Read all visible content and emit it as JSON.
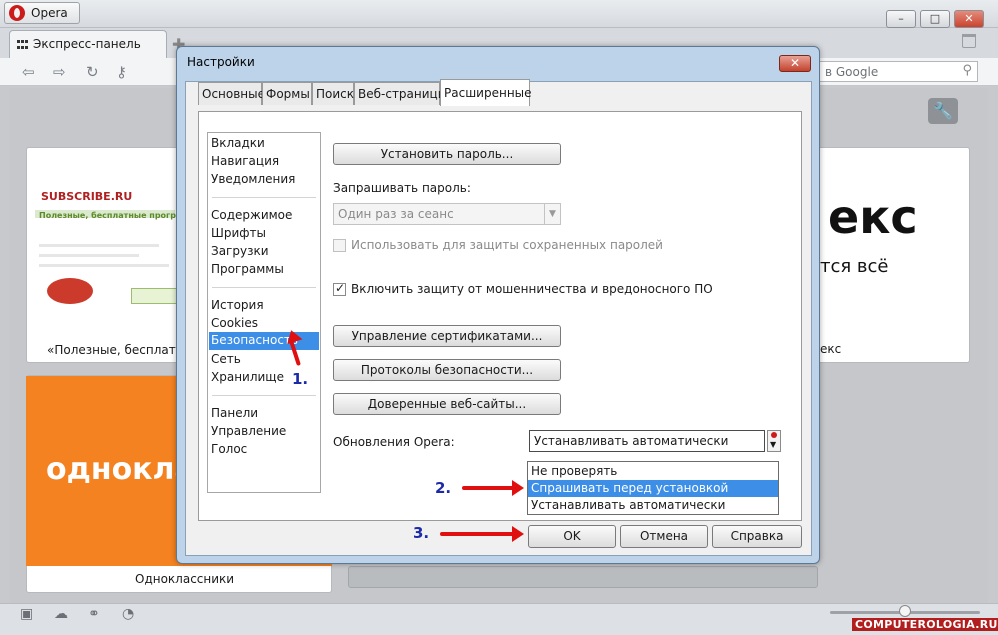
{
  "browser": {
    "app_button": "Opera",
    "tab_label": "Экспресс-панель",
    "search_placeholder": "в Google"
  },
  "speed_dial": {
    "thumb1": {
      "logo": "SUBSCRIBE.RU",
      "headline": "Полезные, бесплатные программ",
      "caption": "«Полезные, бесплатны"
    },
    "thumb2": {
      "big": "екс",
      "small": "тся всё",
      "caption": "екс"
    },
    "thumb3": {
      "text": "однокла",
      "caption": "Одноклассники"
    }
  },
  "dialog": {
    "title": "Настройки",
    "tabs": [
      "Основные",
      "Формы",
      "Поиск",
      "Веб-страницы",
      "Расширенные"
    ],
    "categories": {
      "group1": [
        "Вкладки",
        "Навигация",
        "Уведомления"
      ],
      "group2": [
        "Содержимое",
        "Шрифты",
        "Загрузки",
        "Программы"
      ],
      "group3": [
        "История",
        "Cookies",
        "Безопасность",
        "Сеть",
        "Хранилище"
      ],
      "group4": [
        "Панели",
        "Управление",
        "Голос"
      ]
    },
    "security": {
      "set_password_button": "Установить пароль...",
      "ask_password_label": "Запрашивать пароль:",
      "ask_password_value": "Один раз за сеанс",
      "use_for_saved_passwords": "Использовать для защиты сохраненных паролей",
      "fraud_protection": "Включить защиту от мошенничества и вредоносного ПО",
      "manage_certificates_button": "Управление сертификатами...",
      "security_protocols_button": "Протоколы безопасности...",
      "trusted_sites_button": "Доверенные веб-сайты...",
      "updates_label": "Обновления Opera:",
      "updates_value": "Устанавливать автоматически",
      "updates_options": [
        "Не проверять",
        "Спрашивать перед установкой",
        "Устанавливать автоматически"
      ]
    },
    "buttons": {
      "ok": "OK",
      "cancel": "Отмена",
      "help": "Справка"
    }
  },
  "annotations": {
    "step1": "1.",
    "step2": "2.",
    "step3": "3."
  },
  "watermark": "COMPUTEROLOGIA.RU",
  "colors": {
    "selection": "#3d8ee6",
    "arrow": "#e01010",
    "note": "#1b2aa8",
    "orange_tile": "#f58220"
  }
}
